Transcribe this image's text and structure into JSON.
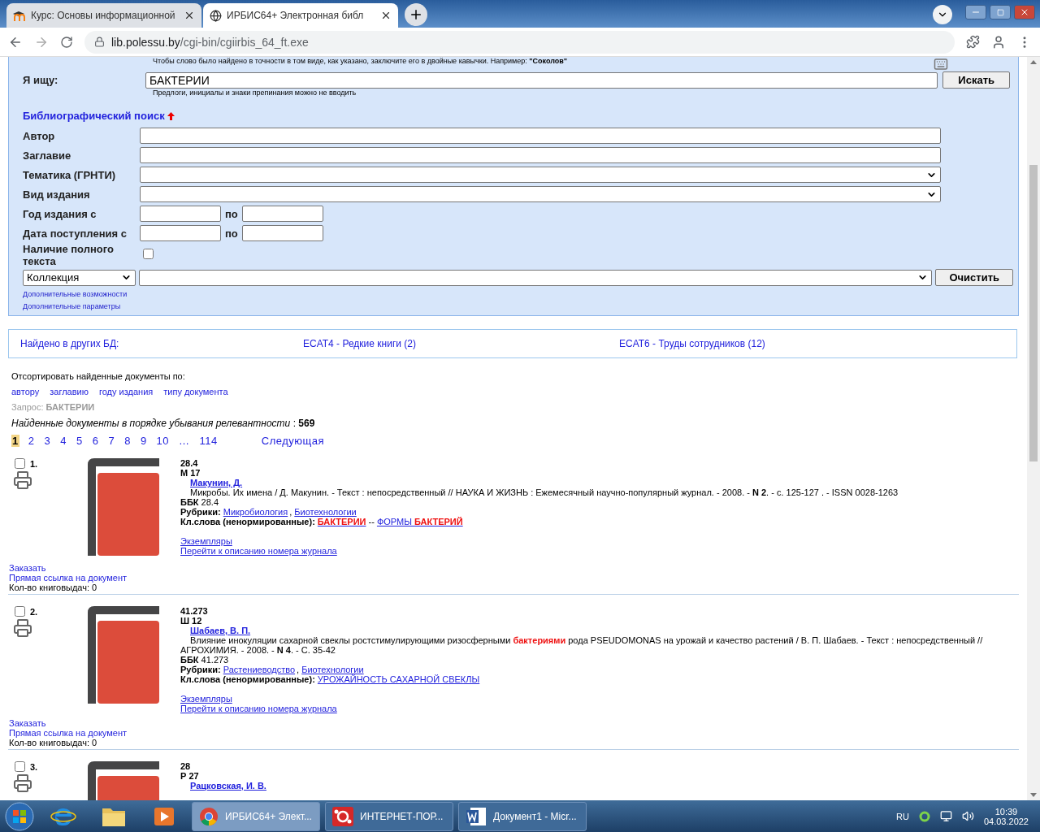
{
  "browser": {
    "tabs": [
      {
        "title": "Курс: Основы информационной",
        "selected": false
      },
      {
        "title": "ИРБИС64+ Электронная библ",
        "selected": true
      }
    ],
    "url": {
      "host": "lib.polessu.by",
      "path": "/cgi-bin/cgiirbis_64_ft.exe"
    }
  },
  "search_form": {
    "hint_top": "Чтобы слово было найдено в точности в том виде, как указано, заключите его в двойные кавычки. Например: **\"Соколов\"**",
    "query_label": "Я ищу:",
    "query_value": "БАКТЕРИИ",
    "search_button": "Искать",
    "hint_bottom": "Предлоги, инициалы и знаки препинания можно не вводить",
    "section_title": "Библиографический поиск",
    "fields": [
      {
        "label": "Автор",
        "kind": "text"
      },
      {
        "label": "Заглавие",
        "kind": "text"
      },
      {
        "label": "Тематика (ГРНТИ)",
        "kind": "select"
      },
      {
        "label": "Вид издания",
        "kind": "select"
      },
      {
        "label": "Год издания с",
        "kind": "range",
        "to_label": "по"
      },
      {
        "label": "Дата поступления с",
        "kind": "range",
        "to_label": "по"
      },
      {
        "label": "Наличие полного текста",
        "kind": "checkbox",
        "checked": false
      }
    ],
    "collection": "Коллекция",
    "clear_button": "Очистить",
    "links": [
      "Дополнительные возможности",
      "Дополнительные параметры"
    ]
  },
  "other_databases": {
    "label": "Найдено в других БД:",
    "links": [
      "ECAT4 - Редкие книги (2)",
      "ECAT6 - Труды сотрудников (12)"
    ]
  },
  "sort": {
    "label": "Отсортировать найденные документы по:",
    "options": [
      "автору",
      "заглавию",
      "году издания",
      "типу документа"
    ]
  },
  "query": {
    "label": "Запрос:",
    "value": "БАКТЕРИИ"
  },
  "results": {
    "caption": "Найденные документы в порядке убывания релевантности",
    "separator": ":",
    "count": "569"
  },
  "pagination": {
    "pages": [
      {
        "label": "1",
        "selected": true
      },
      {
        "label": "2",
        "selected": false
      },
      {
        "label": "3",
        "selected": false
      },
      {
        "label": "4",
        "selected": false
      },
      {
        "label": "5",
        "selected": false
      },
      {
        "label": "6",
        "selected": false
      },
      {
        "label": "7",
        "selected": false
      },
      {
        "label": "8",
        "selected": false
      },
      {
        "label": "9",
        "selected": false
      },
      {
        "label": "10",
        "selected": false
      },
      {
        "label": "…",
        "selected": false
      },
      {
        "label": "114",
        "selected": false
      }
    ],
    "next": "Следующая"
  },
  "records": [
    {
      "number": "1.",
      "checked": false,
      "index": "28.4",
      "author_mark": "М 17",
      "author": "Макунин, Д.",
      "description": [
        {
          "text": "Микробы. Их имена / Д. Макунин. - Текст : непосредственный // НАУКА И ЖИЗНЬ : Ежемесячный научно-популярный журнал. - 2008. - ",
          "kind": "plain"
        },
        {
          "text": "N 2",
          "kind": "bold"
        },
        {
          "text": ". - с. 125-127 . - ISSN 0028-1263",
          "kind": "plain"
        }
      ],
      "bbk_label": "ББК",
      "bbk": "28.4",
      "rubrics_label": "Рубрики:",
      "rubrics": [
        "Микробиология",
        "Биотехнологии"
      ],
      "rubric_separator": ",",
      "keywords_label": "Кл.слова (ненормированные):",
      "keywords": [
        [
          {
            "text": "БАКТЕРИИ",
            "kind": "hit"
          }
        ],
        [
          {
            "text": "ФОРМЫ ",
            "kind": "plain"
          },
          {
            "text": "БАКТЕРИЙ",
            "kind": "hit"
          }
        ]
      ],
      "keyword_separator": "--",
      "links": [
        "Экземпляры",
        "Перейти к описанию номера журнала"
      ],
      "order": "Заказать",
      "direct_link": "Прямая ссылка на документ",
      "loans": "Кол-во книговыдач: 0"
    },
    {
      "number": "2.",
      "checked": false,
      "index": "41.273",
      "author_mark": "Ш 12",
      "author": "Шабаев, В. П.",
      "description": [
        {
          "text": "Влияние инокуляции сахарной свеклы ростстимулирующими ризосферными ",
          "kind": "plain"
        },
        {
          "text": "бактериями",
          "kind": "hit"
        },
        {
          "text": " рода PSEUDOMONAS на урожай и качество растений / В. П. Шабаев. - Текст : непосредственный // АГРОХИМИЯ. - 2008. - ",
          "kind": "plain"
        },
        {
          "text": "N 4",
          "kind": "bold"
        },
        {
          "text": ". - С. 35-42",
          "kind": "plain"
        }
      ],
      "bbk_label": "ББК",
      "bbk": "41.273",
      "rubrics_label": "Рубрики:",
      "rubrics": [
        "Растениеводство",
        "Биотехнологии"
      ],
      "rubric_separator": ",",
      "keywords_label": "Кл.слова (ненормированные):",
      "keywords": [
        [
          {
            "text": "УРОЖАЙНОСТЬ САХАРНОЙ СВЕКЛЫ",
            "kind": "plain"
          }
        ]
      ],
      "links": [
        "Экземпляры",
        "Перейти к описанию номера журнала"
      ],
      "order": "Заказать",
      "direct_link": "Прямая ссылка на документ",
      "loans": "Кол-во книговыдач: 0"
    },
    {
      "number": "3.",
      "checked": false,
      "index": "28",
      "author_mark": "Р 27",
      "author": "Рацковская, И. В."
    }
  ],
  "taskbar": {
    "tasks": [
      {
        "title": "ИРБИС64+ Элект...",
        "selected": true
      },
      {
        "title": "ИНТЕРНЕТ-ПОР...",
        "selected": false
      },
      {
        "title": "Документ1 - Micr...",
        "selected": false
      }
    ],
    "language": "RU",
    "time": "10:39",
    "date": "04.03.2022"
  }
}
